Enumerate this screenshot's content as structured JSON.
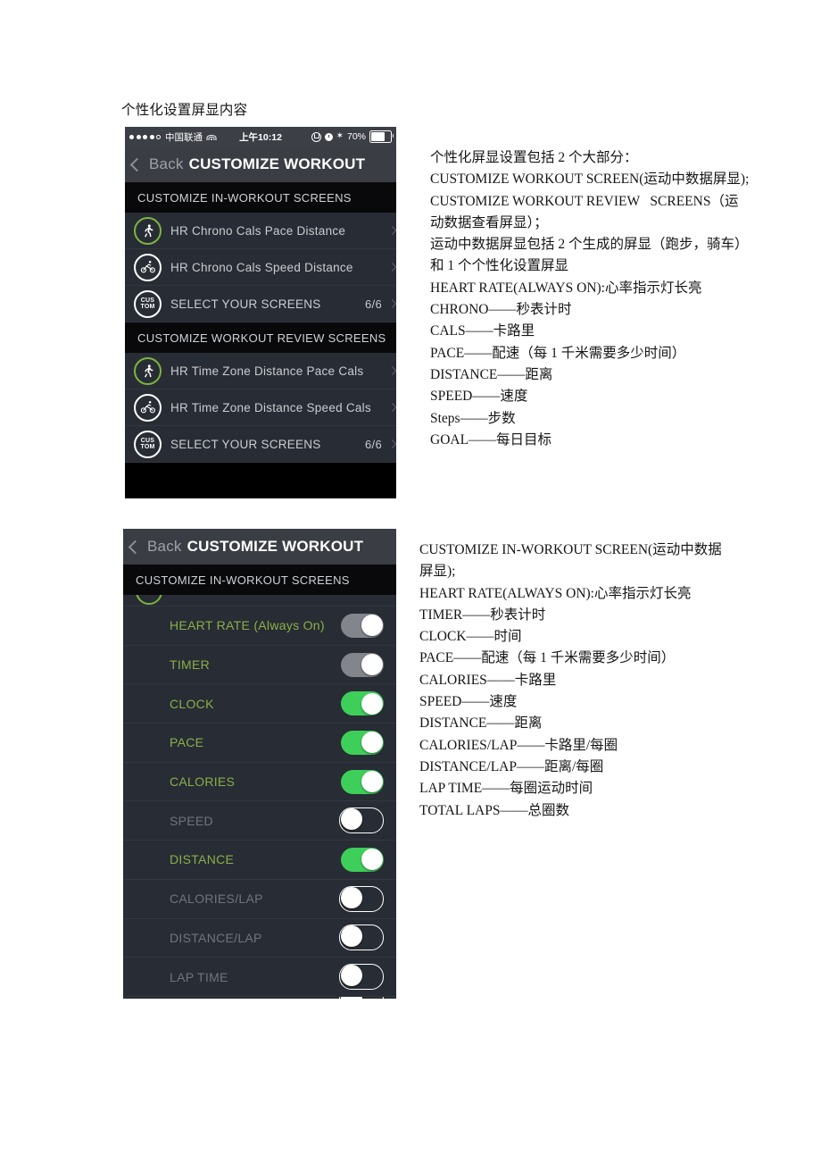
{
  "document": {
    "title": "个性化设置屏显内容"
  },
  "screenshot_one": {
    "status_bar": {
      "carrier": "中国联通",
      "wifi_icon": "wifi-icon",
      "signal_dots": 5,
      "signal_filled": 4,
      "time": "上午10:12",
      "icons": [
        "rotation-lock-icon",
        "alarm-icon",
        "bluetooth-icon"
      ],
      "bluetooth_glyph": "✶",
      "battery_percent": "70%"
    },
    "nav": {
      "back_label": "Back",
      "back_icon": "chevron-left-icon",
      "title": "CUSTOMIZE WORKOUT"
    },
    "sections": [
      {
        "header": "CUSTOMIZE IN-WORKOUT SCREENS",
        "rows": [
          {
            "badge": "running-icon",
            "badge_style": "green",
            "label": "HR  Chrono  Cals  Pace  Distance",
            "count": ""
          },
          {
            "badge": "cycling-icon",
            "badge_style": "white",
            "label": "HR  Chrono  Cals  Speed  Distance",
            "count": ""
          },
          {
            "badge": "custom-badge",
            "badge_style": "white",
            "badge_line1": "CUS",
            "badge_line2": "TOM",
            "label": "SELECT YOUR SCREENS",
            "count": "6/6"
          }
        ]
      },
      {
        "header": "CUSTOMIZE WORKOUT REVIEW SCREENS",
        "rows": [
          {
            "badge": "running-icon",
            "badge_style": "green",
            "label": "HR Time Zone Distance Pace Cals",
            "count": ""
          },
          {
            "badge": "cycling-icon",
            "badge_style": "white",
            "label": "HR Time Zone Distance Speed Cals",
            "count": ""
          },
          {
            "badge": "custom-badge",
            "badge_style": "white",
            "badge_line1": "CUS",
            "badge_line2": "TOM",
            "label": "SELECT YOUR SCREENS",
            "count": "6/6"
          }
        ]
      }
    ]
  },
  "notes_one": {
    "lines": [
      "个性化屏显设置包括 2 个大部分：",
      "CUSTOMIZE WORKOUT SCREEN(运动中数据屏显);",
      "CUSTOMIZE WORKOUT REVIEW   SCREENS（运",
      "动数据查看屏显）；",
      "运动中数据屏显包括 2 个生成的屏显（跑步，骑车）",
      "和 1 个个性化设置屏显",
      "HEART RATE(ALWAYS ON):心率指示灯长亮",
      "CHRONO——秒表计时",
      "CALS——卡路里",
      "PACE——配速（每 1 千米需要多少时间）",
      "DISTANCE——距离",
      "SPEED——速度",
      "Steps——步数",
      "GOAL——每日目标"
    ]
  },
  "screenshot_two": {
    "nav": {
      "back_label": "Back",
      "back_icon": "chevron-left-icon",
      "title": "CUSTOMIZE WORKOUT"
    },
    "section_header": "CUSTOMIZE IN-WORKOUT SCREENS",
    "toggle_rows": [
      {
        "label": "HEART RATE (Always On)",
        "state": "dim"
      },
      {
        "label": "TIMER",
        "state": "dim"
      },
      {
        "label": "CLOCK",
        "state": "on"
      },
      {
        "label": "PACE",
        "state": "on"
      },
      {
        "label": "CALORIES",
        "state": "on"
      },
      {
        "label": "SPEED",
        "state": "off"
      },
      {
        "label": "DISTANCE",
        "state": "on"
      },
      {
        "label": "CALORIES/LAP",
        "state": "off"
      },
      {
        "label": "DISTANCE/LAP",
        "state": "off"
      },
      {
        "label": "LAP TIME",
        "state": "off"
      }
    ]
  },
  "notes_two": {
    "lines": [
      "CUSTOMIZE IN-WORKOUT SCREEN(运动中数据",
      "屏显);",
      "HEART RATE(ALWAYS ON):心率指示灯长亮",
      "TIMER——秒表计时",
      "CLOCK——时间",
      "PACE——配速（每 1 千米需要多少时间）",
      "CALORIES——卡路里",
      "SPEED——速度",
      "DISTANCE——距离",
      "CALORIES/LAP——卡路里/每圈",
      "DISTANCE/LAP——距离/每圈",
      "LAP TIME——每圈运动时间",
      "TOTAL LAPS——总圈数"
    ]
  },
  "colors": {
    "accent_green": "#3ecf5a",
    "label_green": "#8ab04a",
    "ring_green": "#7cb342",
    "row_bg": "#282c34",
    "section_header_bg": "#09090b",
    "navbar_bg": "#3a3d43",
    "statusbar_bg": "#3c3f45"
  }
}
